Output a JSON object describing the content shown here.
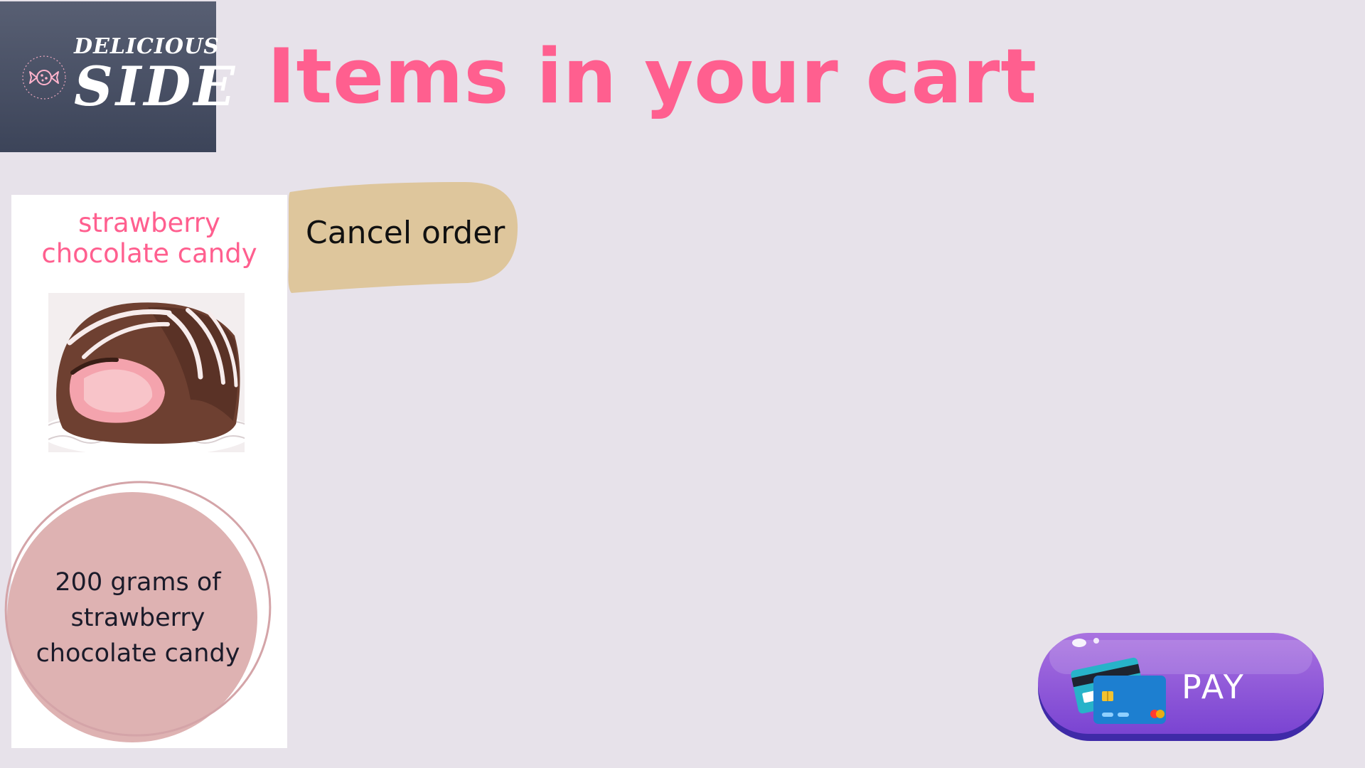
{
  "brand": {
    "logo_top": "DELICIOUS",
    "logo_main": "SIDE"
  },
  "header": {
    "title": "Items in your cart"
  },
  "cart": {
    "items": [
      {
        "name_line1": "strawberry",
        "name_line2": "chocolate candy",
        "description_line1": "200 grams of",
        "description_line2": "strawberry",
        "description_line3": "chocolate candy"
      }
    ]
  },
  "actions": {
    "cancel_label": "Cancel order",
    "pay_label": "PAY"
  },
  "colors": {
    "background": "#e7e2ea",
    "title": "#ff5f8f",
    "logo_bg": "#474e63",
    "cancel_bg": "#dec69c",
    "pay_bg": "#8a4fd6",
    "description_circle": "#deb2b2"
  },
  "icons": {
    "logo": "candy-icon",
    "pay": "credit-card-icon"
  }
}
